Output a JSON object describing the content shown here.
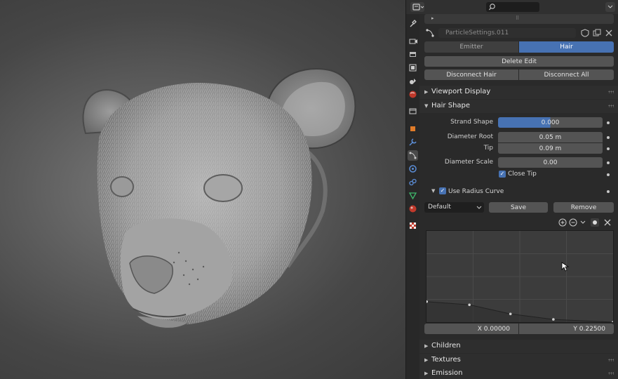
{
  "header": {
    "search_placeholder": ""
  },
  "datablock": {
    "name": "ParticleSettings.011"
  },
  "mode_tabs": {
    "emitter": "Emitter",
    "hair": "Hair"
  },
  "buttons": {
    "delete_edit": "Delete Edit",
    "disconnect_hair": "Disconnect Hair",
    "disconnect_all": "Disconnect All"
  },
  "sections": {
    "viewport_display": "Viewport Display",
    "hair_shape": "Hair Shape",
    "children": "Children",
    "textures": "Textures",
    "emission": "Emission"
  },
  "hair_shape": {
    "strand_shape_label": "Strand Shape",
    "strand_shape_value": "0.000",
    "diameter_root_label": "Diameter Root",
    "diameter_root_value": "0.05 m",
    "tip_label": "Tip",
    "tip_value": "0.09 m",
    "diameter_scale_label": "Diameter Scale",
    "diameter_scale_value": "0.00",
    "close_tip_label": "Close Tip",
    "close_tip_checked": true,
    "use_radius_curve_label": "Use Radius Curve",
    "use_radius_curve_checked": true
  },
  "curve": {
    "preset": "Default",
    "save": "Save",
    "remove": "Remove",
    "x_readout": "X 0.00000",
    "y_readout": "Y 0.22500",
    "points": [
      [
        0.0,
        0.225
      ],
      [
        0.23,
        0.19
      ],
      [
        0.45,
        0.09
      ],
      [
        0.68,
        0.03
      ],
      [
        1.0,
        0.0
      ]
    ]
  },
  "colors": {
    "accent": "#4772b3",
    "panel": "#2a2a2a",
    "field": "#545454"
  },
  "icons": {
    "tabs": [
      "tool-icon",
      "render-icon",
      "output-icon",
      "view-layer-icon",
      "scene-icon",
      "world-icon",
      "collection-icon",
      "object-icon",
      "modifier-icon",
      "particles-icon",
      "physics-icon",
      "constraints-icon",
      "data-icon",
      "material-icon",
      "texture-icon"
    ]
  }
}
